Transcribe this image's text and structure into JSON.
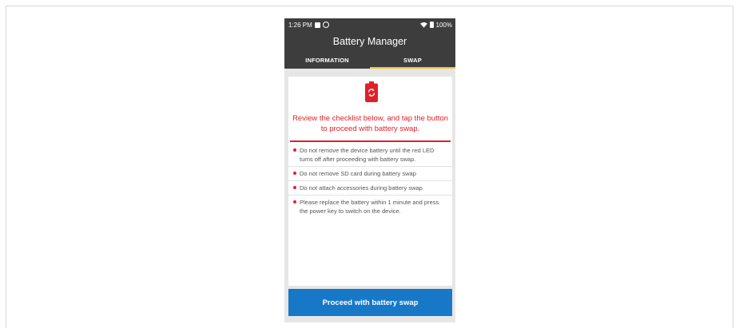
{
  "status_bar": {
    "time": "1:26 PM",
    "battery_percent": "100%"
  },
  "app_bar": {
    "title": "Battery Manager"
  },
  "tabs": [
    {
      "label": "INFORMATION",
      "active": false
    },
    {
      "label": "SWAP",
      "active": true
    }
  ],
  "hero": {
    "icon": "battery-swap-icon",
    "message": "Review the checklist below, and tap the button to proceed with battery swap."
  },
  "checklist": [
    "Do not remove the device battery until the red LED turns off after proceeding with battery swap.",
    "Do not remove SD card during battery swap",
    "Do not attach accessories during battery swap",
    "Please replace the battery within 1 minute and press the power key to switch on the device."
  ],
  "proceed_button": {
    "label": "Proceed with battery swap"
  },
  "colors": {
    "accent_red": "#e0202a",
    "button_blue": "#1878c8",
    "bar_dark": "#3d3d3d",
    "tab_indicator": "#f2c230"
  }
}
